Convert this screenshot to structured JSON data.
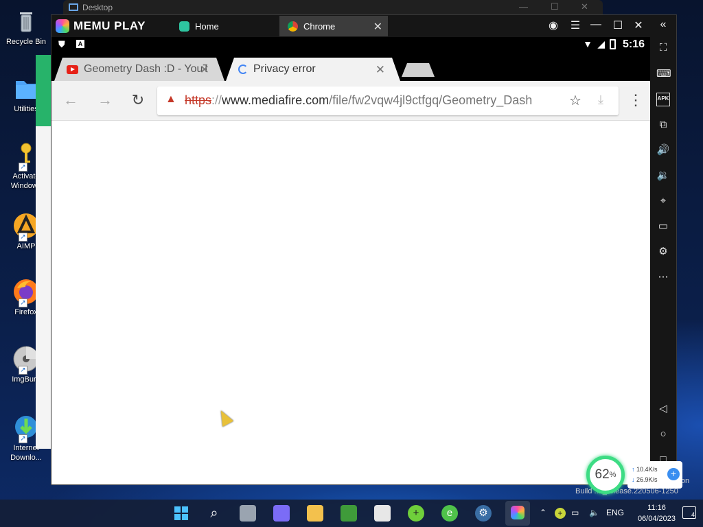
{
  "desktop": {
    "background_window_title": "Desktop",
    "icons": [
      {
        "label": "Recycle Bin",
        "icon": "recycle-bin-icon"
      },
      {
        "label": "Utilities",
        "icon": "folder-icon"
      },
      {
        "label": "Activate Windows",
        "icon": "key-icon"
      },
      {
        "label": "AIMP",
        "icon": "aimp-icon"
      },
      {
        "label": "Firefox",
        "icon": "firefox-icon"
      },
      {
        "label": "ImgBurn",
        "icon": "imgburn-disc-icon"
      },
      {
        "label": "Internet Downlo...",
        "icon": "internet-download-manager-icon"
      }
    ]
  },
  "memu": {
    "brand": "MEMU PLAY",
    "tabs": [
      {
        "label": "Home",
        "icon": "home-app-icon"
      },
      {
        "label": "Chrome",
        "icon": "chrome-icon"
      }
    ],
    "sidebar_icons": [
      "fullscreen-icon",
      "keyboard-icon",
      "apk-icon",
      "multi-instance-icon",
      "volume-up-icon",
      "volume-down-icon",
      "location-icon",
      "folder-icon",
      "settings-icon",
      "more-icon",
      "back-icon",
      "home-icon",
      "recents-icon"
    ]
  },
  "android": {
    "status_time": "5:16"
  },
  "chrome": {
    "tabs": [
      {
        "label": "Geometry Dash :D - YouT",
        "favicon": "youtube-icon",
        "active": false
      },
      {
        "label": "Privacy error",
        "favicon": "loading-spinner-icon",
        "active": true
      }
    ],
    "omnibox": {
      "scheme": "https",
      "separator": "://",
      "host": "www.mediafire.com",
      "path": "/file/fw2vqw4jl9ctfgq/Geometry_Dash"
    },
    "colors": {
      "warning": "#c53929"
    }
  },
  "network_widget": {
    "cpu_percent": "62",
    "percent_sign": "%",
    "upload": "10.4K/s",
    "download": "26.9K/s"
  },
  "watermark": {
    "line1": "ition",
    "line2": "Build ... _release.220506-1250"
  },
  "taskbar": {
    "language": "ENG",
    "time": "11:16",
    "date": "06/04/2023",
    "notification_count": "4"
  }
}
